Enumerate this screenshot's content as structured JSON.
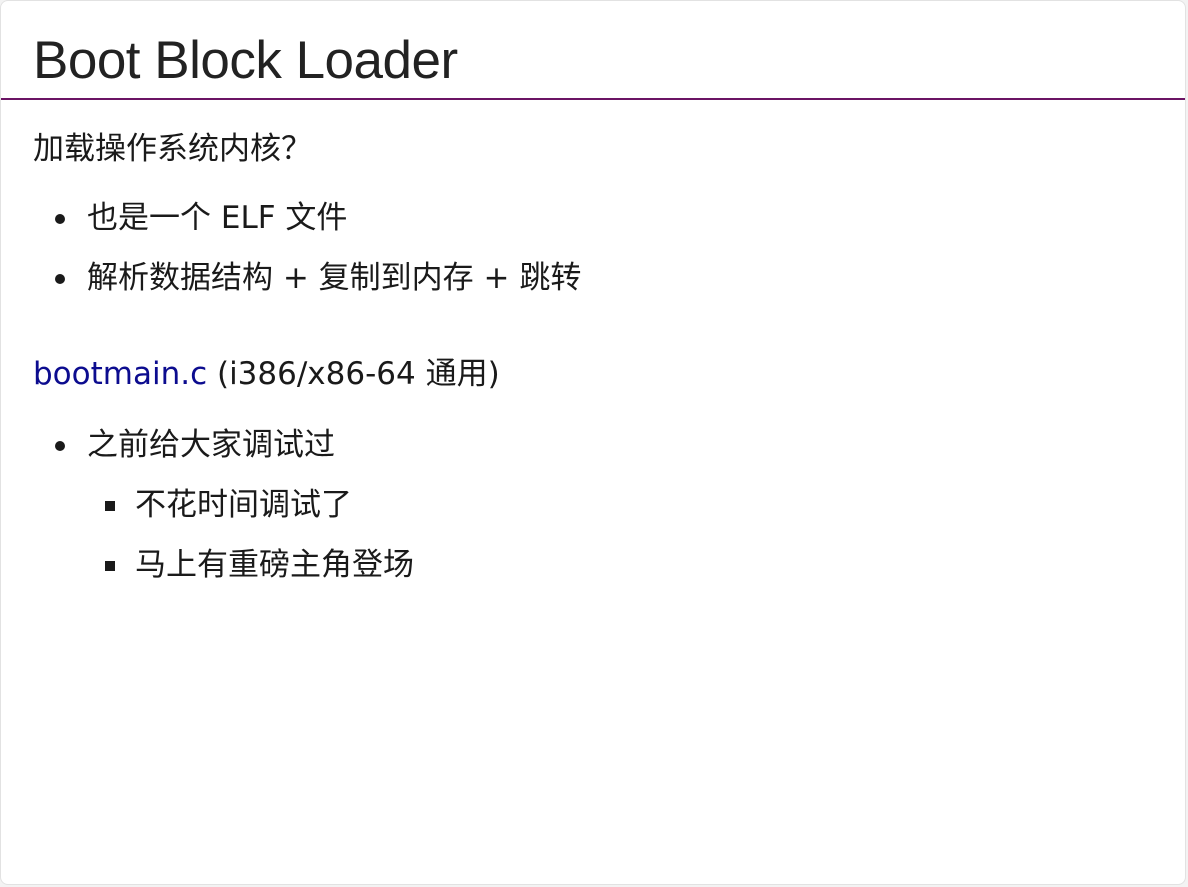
{
  "slide": {
    "title": "Boot Block Loader",
    "intro_question": "加载操作系统内核？",
    "intro_bullets": [
      "也是一个 ELF 文件",
      "解析数据结构 + 复制到内存 + 跳转"
    ],
    "source_link": "bootmain.c",
    "source_note": " (i386/x86-64 通用)",
    "source_bullets": [
      {
        "text": "之前给大家调试过",
        "children": [
          "不花时间调试了",
          "马上有重磅主角登场"
        ]
      }
    ]
  },
  "colors": {
    "title_rule": "#6b1464",
    "link": "#0c0c8f",
    "text": "#1a1a1a"
  }
}
